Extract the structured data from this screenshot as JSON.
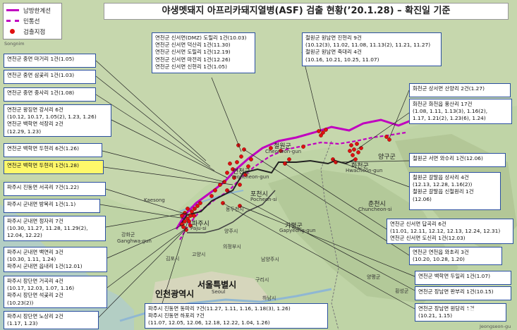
{
  "title": "야생멧돼지 아프리카돼지열병(ASF) 검출 현황(’20.1.28) – 확진일 기준",
  "legend": [
    {
      "label": "남방한계선",
      "symbol": "solid-line",
      "color": "#c000c0"
    },
    {
      "label": "민통선",
      "symbol": "dashed-line",
      "color": "#c000c0"
    },
    {
      "label": "검출지점",
      "symbol": "dot",
      "color": "#e01010"
    }
  ],
  "left_boxes": [
    {
      "lines": [
        "연천군 중면 마거리 1건(1.05)"
      ],
      "highlight": false
    },
    {
      "lines": [
        "연천군 중면 삼곶리 1건(1.03)"
      ],
      "highlight": false
    },
    {
      "lines": [
        "연천군 중면 중사리 1건(1.08)"
      ],
      "highlight": false
    },
    {
      "lines": [
        "연천군 왕징면 강서리 6건",
        "(10.12, 10.17, 1.05(2), 1.23, 1.26)",
        "연천군 백학면 석장리 2건",
        "(12.29, 1.23)"
      ],
      "highlight": false
    },
    {
      "lines": [
        "연천군 백학면 두현리 6건(1.26)"
      ],
      "highlight": false
    },
    {
      "lines": [
        "연천군 백학면 두현리 1건(1.28)"
      ],
      "highlight": true
    },
    {
      "lines": [
        "파주시 진동면 서곡리 7건(1.22)"
      ],
      "highlight": false
    },
    {
      "lines": [
        "파주시 군내면 방목리 1건(1.1)"
      ],
      "highlight": false
    },
    {
      "lines": [
        "파주시 군내면 정자리 7건",
        "(10.30, 11.27, 11.28, 11.29(2),",
        "12.04, 12.22)"
      ],
      "highlight": false
    },
    {
      "lines": [
        "파주시 군내면 백연리 3건",
        "(10.30, 1.11, 1.24)",
        "파주시 군내면 읍내리 1건(12.01)"
      ],
      "highlight": false
    },
    {
      "lines": [
        "파주시 장단면 거곡리 4건",
        "(10.17, 12.03, 1.07, 1.16)",
        "파주시 장단면 석곶리 2건",
        "(10.23(2))"
      ],
      "highlight": false
    },
    {
      "lines": [
        "파주시 장단면 노상리 2건",
        "(1.17, 1.23)"
      ],
      "highlight": false
    }
  ],
  "top_box": {
    "lines": [
      "연천군 신서면(DMZ) 도밀리 1건(10.03)",
      "연천군 신서면 덕산리 1건(11.30)",
      "연천군 신서면 도밀리 1건(12.19)",
      "연천군 신서면 마전리 1건(12.26)",
      "연천군 신서면 신현리 1건(1.05)"
    ]
  },
  "cheorwon_box": {
    "lines": [
      "철원군 원남면 진현리 9건",
      "(10.12(3), 11.02, 11.08, 11.13(2), 11.21, 11.27)",
      "철원군 원남면 죽대리 4건",
      "(10.16, 10.21, 10.25, 11.07)"
    ]
  },
  "right_boxes": [
    {
      "lines": [
        "화천군 상서면 산양리 2건(1.27)"
      ]
    },
    {
      "lines": [
        "화천군 화천읍 풍산리 17건",
        "(1.08, 1.11, 1.13(3), 1.16(2),",
        "1.17, 1.21(2), 1.23(6), 1.24)"
      ]
    },
    {
      "lines": [
        "철원군 서면 와수리 1건(12.06)"
      ]
    },
    {
      "lines": [
        "철원군 갈말읍 상사리 4건",
        "(12.13, 12.28, 1.16(2))",
        "철원군 갈말읍 신철원리 1건",
        "(12.06)"
      ]
    },
    {
      "lines": [
        "연천군 신서면 답곡리 6건",
        "(11.01, 12.11, 12.12, 12.13, 12.24, 12.31)",
        "연천군 신서면 도신리 1건(12.03)"
      ]
    },
    {
      "lines": [
        "연천군 연천읍 와초리 3건",
        "(10.20, 10.28, 1.20)"
      ]
    },
    {
      "lines": [
        "연천군 백학면 두일리 1건(1.07)"
      ]
    },
    {
      "lines": [
        "연천군 장남면 판부리 1건(10.15)"
      ]
    },
    {
      "lines": [
        "연천군 장남면 원당리 1건",
        "(10.21, 1.15)"
      ]
    }
  ],
  "bottom_box": {
    "lines": [
      "파주시 진동면 동파리 7건(11.27, 1.11, 1.16, 1.18(3), 1.26)",
      "파주시 진동면 하포리 7건",
      "(11.07, 12.05, 12.06, 12.18, 12.22, 1.04, 1.26)"
    ]
  },
  "places": [
    {
      "name": "Songnim",
      "kind": "corner"
    },
    {
      "name": "연천군",
      "kind": "mid"
    },
    {
      "name": "Yeoncheon-gun",
      "kind": "small"
    },
    {
      "name": "포천시",
      "kind": "mid"
    },
    {
      "name": "Pocheon-si",
      "kind": "small"
    },
    {
      "name": "철원군",
      "kind": "mid"
    },
    {
      "name": "Cheorwon-gun",
      "kind": "small"
    },
    {
      "name": "화천군",
      "kind": "mid"
    },
    {
      "name": "Hwacheon-gun",
      "kind": "small"
    },
    {
      "name": "양구군",
      "kind": "mid"
    },
    {
      "name": "춘천시",
      "kind": "mid"
    },
    {
      "name": "Chuncheon-si",
      "kind": "small"
    },
    {
      "name": "Kaesong",
      "kind": "small"
    },
    {
      "name": "파주시",
      "kind": "mid"
    },
    {
      "name": "Paju-si",
      "kind": "small"
    },
    {
      "name": "동두천시",
      "kind": "small"
    },
    {
      "name": "가평군",
      "kind": "mid"
    },
    {
      "name": "Gapyeong-gun",
      "kind": "small"
    },
    {
      "name": "양주시",
      "kind": "small"
    },
    {
      "name": "의정부시",
      "kind": "small"
    },
    {
      "name": "남양주시",
      "kind": "small"
    },
    {
      "name": "김포시",
      "kind": "small"
    },
    {
      "name": "강화군",
      "kind": "small"
    },
    {
      "name": "Ganghwa-gun",
      "kind": "small"
    },
    {
      "name": "고양시",
      "kind": "small"
    },
    {
      "name": "서울특별시",
      "kind": "big"
    },
    {
      "name": "Seoul",
      "kind": "small"
    },
    {
      "name": "인천광역시",
      "kind": "big"
    },
    {
      "name": "구리시",
      "kind": "small"
    },
    {
      "name": "하남시",
      "kind": "small"
    },
    {
      "name": "양평군",
      "kind": "small"
    },
    {
      "name": "횡성군",
      "kind": "small"
    },
    {
      "name": "Jeongseon-gu",
      "kind": "corner"
    }
  ],
  "watermark": "TCN"
}
